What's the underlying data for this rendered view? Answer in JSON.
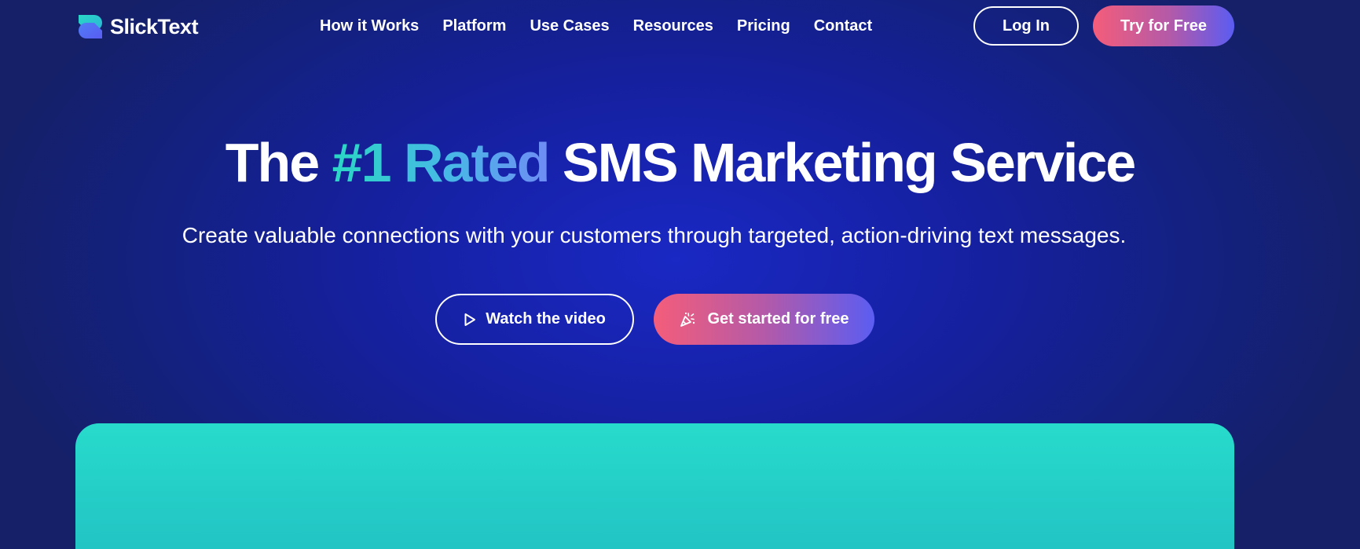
{
  "header": {
    "logo_text": "SlickText",
    "nav": [
      {
        "label": "How it Works"
      },
      {
        "label": "Platform"
      },
      {
        "label": "Use Cases"
      },
      {
        "label": "Resources"
      },
      {
        "label": "Pricing"
      },
      {
        "label": "Contact"
      }
    ],
    "login_label": "Log In",
    "try_label": "Try for Free"
  },
  "hero": {
    "title_prefix": "The",
    "title_accent": "#1 Rated",
    "title_suffix": "SMS Marketing Service",
    "subtitle": "Create valuable connections with your customers through targeted, action-driving text messages.",
    "watch_label": "Watch the video",
    "start_label": "Get started for free"
  },
  "icons": {
    "logo": "slicktext-logo-icon",
    "watch": "play-icon",
    "start": "party-popper-icon"
  },
  "colors": {
    "background": "#15209e",
    "accent_teal": "#2ad7c4",
    "accent_blue": "#6f8cf5",
    "cta_pink": "#f45d7a",
    "cta_violet": "#5b5df2",
    "panel_teal": "#27dbcb"
  }
}
